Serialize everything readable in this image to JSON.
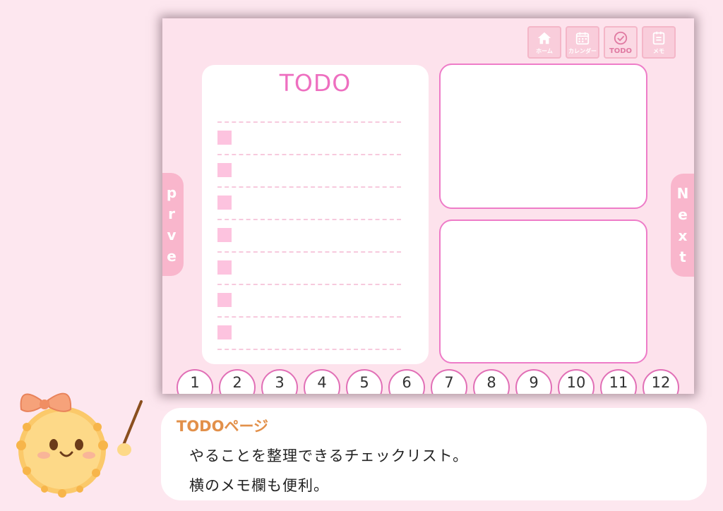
{
  "nav": {
    "home_label": "ホーム",
    "calendar_label": "カレンダー",
    "todo_label": "TODO",
    "memo_label": "メモ"
  },
  "todo": {
    "title": "TODO",
    "item_count": 7
  },
  "side": {
    "prev_label": "prve",
    "next_label": "Next"
  },
  "months": [
    "1",
    "2",
    "3",
    "4",
    "5",
    "6",
    "7",
    "8",
    "9",
    "10",
    "11",
    "12"
  ],
  "caption": {
    "title": "TODOページ",
    "line1": "やることを整理できるチェックリスト。",
    "line2": "横のメモ欄も便利。"
  },
  "colors": {
    "background": "#fde7ef",
    "accent_pink": "#ee6fc0",
    "tab_pink": "#f9b6cc",
    "caption_title": "#e2904a"
  }
}
